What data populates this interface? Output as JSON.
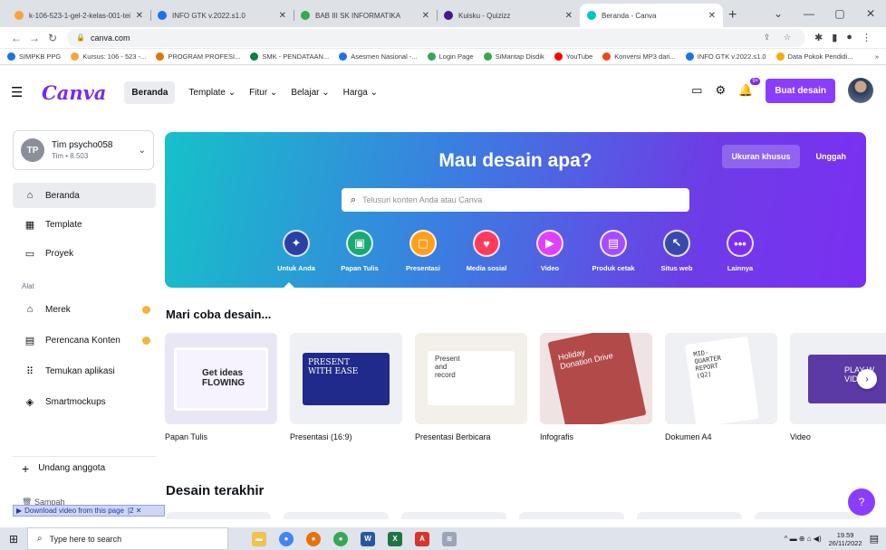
{
  "browser": {
    "tabs": [
      {
        "title": "k-106-523-1-gel-2-kelas-001-tei",
        "color": "#f2a73b"
      },
      {
        "title": "INFO GTK v.2022.s1.0",
        "color": "#1a73e8"
      },
      {
        "title": "BAB III SK INFORMATIKA",
        "color": "#34a853"
      },
      {
        "title": "Kuisku - Quizizz",
        "color": "#46178f"
      },
      {
        "title": "Beranda - Canva",
        "color": "#00c4cc"
      }
    ],
    "new_tab": "+",
    "url": "canva.com",
    "bookmarks": [
      {
        "label": "SIMPKB PPG",
        "color": "#1a73e8"
      },
      {
        "label": "Kursus: 106 - 523 -...",
        "color": "#f2a73b"
      },
      {
        "label": "PROGRAM PROFESI...",
        "color": "#e37400"
      },
      {
        "label": "SMK - PENDATAAN...",
        "color": "#0b8043"
      },
      {
        "label": "Asesmen Nasional -...",
        "color": "#1a73e8"
      },
      {
        "label": "Login Page",
        "color": "#34a853"
      },
      {
        "label": "SiMantap Disdik",
        "color": "#34a853"
      },
      {
        "label": "YouTube",
        "color": "#ff0000"
      },
      {
        "label": "Konversi MP3 dari...",
        "color": "#e64a19"
      },
      {
        "label": "INFO GTK v.2022.s1.0",
        "color": "#1a73e8"
      },
      {
        "label": "Data Pokok Pendidi...",
        "color": "#f9ab00"
      }
    ]
  },
  "header": {
    "logo": "Canva",
    "nav": [
      {
        "label": "Beranda",
        "selected": true
      },
      {
        "label": "Template ⌄",
        "selected": false
      },
      {
        "label": "Fitur ⌄",
        "selected": false
      },
      {
        "label": "Belajar ⌄",
        "selected": false
      },
      {
        "label": "Harga ⌄",
        "selected": false
      }
    ],
    "notif_badge": "9+",
    "create_button": "Buat desain",
    "accent": "#8b3dff"
  },
  "sidebar": {
    "team_initials": "TP",
    "team_name": "Tim psycho058",
    "team_sub": "Tim • 8.503",
    "items": [
      {
        "label": "Beranda",
        "icon": "home-icon",
        "glyph": "⌂"
      },
      {
        "label": "Template",
        "icon": "template-icon",
        "glyph": "▦"
      },
      {
        "label": "Proyek",
        "icon": "folder-icon",
        "glyph": "▭"
      }
    ],
    "tools_heading": "Alat",
    "tools": [
      {
        "label": "Merek",
        "icon": "brand-icon",
        "glyph": "⌂",
        "dot": true
      },
      {
        "label": "Perencana Konten",
        "icon": "calendar-icon",
        "glyph": "▤",
        "dot": true
      },
      {
        "label": "Temukan aplikasi",
        "icon": "apps-icon",
        "glyph": "⠿",
        "dot": false
      },
      {
        "label": "Smartmockups",
        "icon": "smartmockups-icon",
        "glyph": "◈",
        "dot": false
      }
    ],
    "invite": "Undang anggota",
    "trash": "Sampah",
    "download_bar": "Download video from this page"
  },
  "hero": {
    "title": "Mau desain apa?",
    "custom_size": "Ukuran khusus",
    "upload": "Unggah",
    "search_placeholder": "Telusuri konten Anda atau Canva",
    "categories": [
      {
        "label": "Untuk Anda",
        "icon": "sparkle-icon",
        "glyph": "✦",
        "color": "#2b3fa8"
      },
      {
        "label": "Papan Tulis",
        "icon": "whiteboard-icon",
        "glyph": "▣",
        "color": "#19a974"
      },
      {
        "label": "Presentasi",
        "icon": "presentation-icon",
        "glyph": "▢",
        "color": "#ff9f1c"
      },
      {
        "label": "Media sosial",
        "icon": "heart-icon",
        "glyph": "♥",
        "color": "#ff3b5c"
      },
      {
        "label": "Video",
        "icon": "video-icon",
        "glyph": "▶",
        "color": "#e040fb"
      },
      {
        "label": "Produk cetak",
        "icon": "print-icon",
        "glyph": "▤",
        "color": "#a64dff"
      },
      {
        "label": "Situs web",
        "icon": "website-icon",
        "glyph": "↖",
        "color": "#3949ab"
      },
      {
        "label": "Lainnya",
        "icon": "more-icon",
        "glyph": "•••",
        "color": "#7b2ff2"
      }
    ]
  },
  "try_section": {
    "title": "Mari coba desain...",
    "tiles": [
      {
        "label": "Papan Tulis",
        "thumb_text": "Get ideas\nFLOWING"
      },
      {
        "label": "Presentasi (16:9)",
        "thumb_text": "PRESENT\nWITH EASE"
      },
      {
        "label": "Presentasi Berbicara",
        "thumb_text": "Present\nand\nrecord"
      },
      {
        "label": "Infografis",
        "thumb_text": "Holiday\nDonation Drive"
      },
      {
        "label": "Dokumen A4",
        "thumb_text": "MID-\nQUARTER\nREPORT\n(Q2)"
      },
      {
        "label": "Video",
        "thumb_text": "PLAY W\nVIDE"
      }
    ]
  },
  "recent_section": {
    "title": "Desain terakhir"
  },
  "help_button": "?",
  "taskbar": {
    "search_placeholder": "Type here to search",
    "time": "19.59",
    "date": "26/11/2022"
  }
}
